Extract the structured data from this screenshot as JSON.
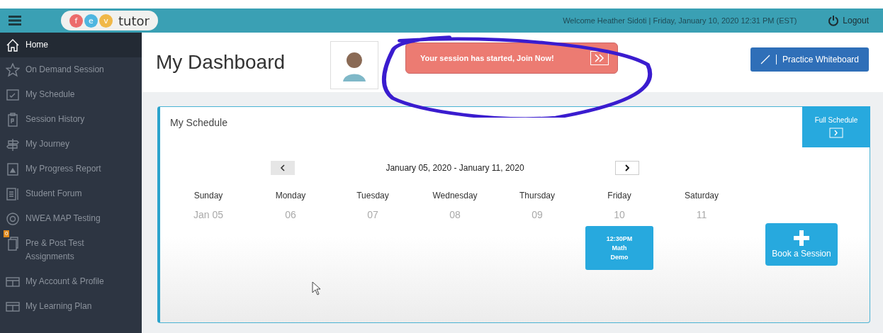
{
  "header": {
    "logo_letters": [
      "f",
      "e",
      "v"
    ],
    "logo_text": "tutor",
    "welcome": "Welcome Heather Sidoti | Friday, January 10, 2020 12:31 PM (EST)",
    "logout": "Logout"
  },
  "sidebar": {
    "items": [
      {
        "label": "Home",
        "selected": true
      },
      {
        "label": "On Demand Session",
        "selected": false
      },
      {
        "label": "My Schedule",
        "selected": false
      },
      {
        "label": "Session History",
        "selected": false
      },
      {
        "label": "My Journey",
        "selected": false
      },
      {
        "label": "My Progress Report",
        "selected": false
      },
      {
        "label": "Student Forum",
        "selected": false
      },
      {
        "label": "NWEA MAP Testing",
        "selected": false
      },
      {
        "label": "Pre & Post Test Assignments",
        "selected": false,
        "badge": "0"
      },
      {
        "label": "My Account & Profile",
        "selected": false
      },
      {
        "label": "My Learning Plan",
        "selected": false
      }
    ]
  },
  "page": {
    "title": "My Dashboard",
    "session_alert": "Your session has started, Join Now!",
    "whiteboard_button": "Practice Whiteboard"
  },
  "schedule": {
    "title": "My Schedule",
    "full_schedule": "Full Schedule",
    "range": "January 05, 2020 - January 11, 2020",
    "days": [
      {
        "name": "Sunday",
        "date": "Jan 05"
      },
      {
        "name": "Monday",
        "date": "06"
      },
      {
        "name": "Tuesday",
        "date": "07"
      },
      {
        "name": "Wednesday",
        "date": "08"
      },
      {
        "name": "Thursday",
        "date": "09"
      },
      {
        "name": "Friday",
        "date": "10",
        "event": [
          "12:30PM",
          "Math",
          "Demo"
        ]
      },
      {
        "name": "Saturday",
        "date": "11"
      }
    ],
    "book_button": "Book a Session"
  }
}
